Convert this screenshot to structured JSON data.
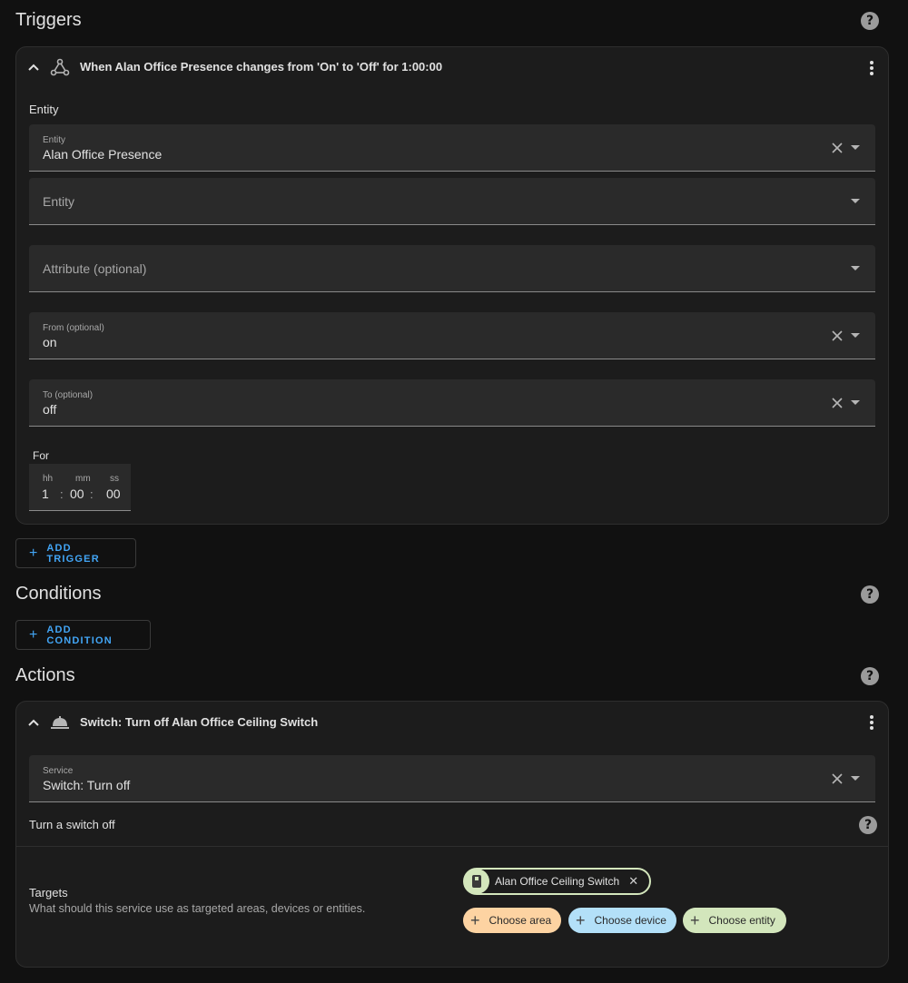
{
  "triggers": {
    "title": "Triggers",
    "help": "?",
    "card": {
      "header": "When Alan Office Presence changes from 'On' to 'Off' for 1:00:00",
      "section_label": "Entity",
      "entity_field": {
        "label": "Entity",
        "value": "Alan Office Presence"
      },
      "entity_field_2": {
        "placeholder": "Entity"
      },
      "attribute_field": {
        "placeholder": "Attribute (optional)"
      },
      "from_field": {
        "label": "From (optional)",
        "value": "on"
      },
      "to_field": {
        "label": "To (optional)",
        "value": "off"
      },
      "for_label": "For",
      "duration": {
        "hh_label": "hh",
        "mm_label": "mm",
        "ss_label": "ss",
        "hh": "1",
        "mm": "00",
        "ss": "00",
        "sep": ":"
      }
    },
    "add_button": "ADD TRIGGER"
  },
  "conditions": {
    "title": "Conditions",
    "help": "?",
    "add_button": "ADD CONDITION"
  },
  "actions": {
    "title": "Actions",
    "help": "?",
    "card": {
      "header": "Switch: Turn off Alan Office Ceiling Switch",
      "service_field": {
        "label": "Service",
        "value": "Switch: Turn off"
      },
      "description": "Turn a switch off",
      "targets_title": "Targets",
      "targets_desc": "What should this service use as targeted areas, devices or entities.",
      "entity_chip": "Alan Office Ceiling Switch",
      "choose_area": "Choose area",
      "choose_device": "Choose device",
      "choose_entity": "Choose entity"
    }
  },
  "colors": {
    "background": "#111111",
    "card": "#1c1c1c",
    "accent": "#42a5f5",
    "area_chip": "#fdd3a2",
    "device_chip": "#b3e0f8",
    "entity_chip": "#d3e6bc"
  }
}
